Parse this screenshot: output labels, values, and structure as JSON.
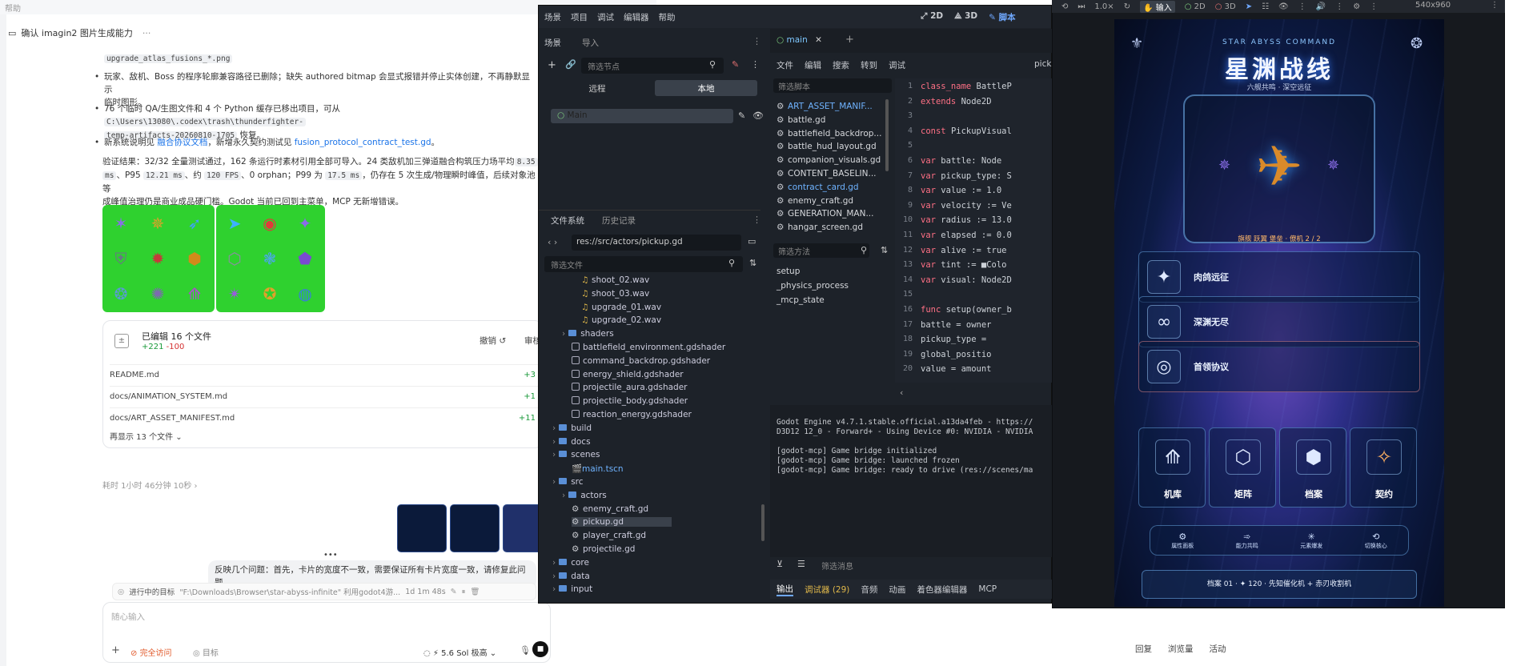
{
  "chat": {
    "top_strip": "帮助",
    "header_title": "确认 imagin2 图片生成能力",
    "header_more": "···",
    "frag_code": "upgrade_atlas_fusions_*.png",
    "bullet1_text": "玩家、敌机、Boss 的程序轮廓兼容路径已删除；缺失 authored bitmap 会显式报错并停止实体创建，不再静默显示",
    "bullet1_cont": "临时图形。",
    "bullet2_a": "76 个临时 QA/生图文件和 4 个 Python 缓存已移出项目，可从",
    "bullet2_code1": "C:\\Users\\13080\\.codex\\trash\\thunderfighter-",
    "bullet2_code2": "temp-artifacts-20260810-1705",
    "bullet2_b": "恢复。",
    "bullet3_a": "新系统说明见",
    "bullet3_link1": "融合协议文档",
    "bullet3_b": "，新增永久契约测试见",
    "bullet3_link2": "fusion_protocol_contract_test.gd",
    "bullet3_c": "。",
    "verify_1": "验证结果：32/32 全量测试通过，162 条运行时素材引用全部可导入。24 类敌机加三弹道融合构筑压力场平均",
    "verify_code1": "8.35",
    "verify_code2": "ms",
    "verify_2": "、P95",
    "verify_code3": "12.21 ms",
    "verify_3": "、约",
    "verify_code4": "120 FPS",
    "verify_4": "、0 orphan；P99 为",
    "verify_code5": "17.5 ms",
    "verify_5": "，仍存在 5 次生成/物理瞬时峰值，后续对象池等",
    "verify_6": "成峰值治理仍是商业成品硬门槛。Godot 当前已回到主菜单，MCP 无新增错误。",
    "edits_title": "已编辑 16 个文件",
    "edits_add": "+221",
    "edits_del": "-100",
    "undo_label": "撤销",
    "review_label": "审核",
    "files": [
      {
        "name": "README.md",
        "delta": "+3"
      },
      {
        "name": "docs/ANIMATION_SYSTEM.md",
        "delta": "+1"
      },
      {
        "name": "docs/ART_ASSET_MANIFEST.md",
        "delta": "+11"
      }
    ],
    "show_more": "再显示 13 个文件",
    "elapsed": "耗时 1小时 46分钟 10秒",
    "user_msg": "反映几个问题：首先，卡片的宽度不一致，需要保证所有卡片宽度一致，请修复此问",
    "user_msg2": "题，",
    "task_label": "进行中的目标",
    "task_path": "\"F:\\Downloads\\Browser\\star-abyss-infinite\" 利用godot4游...",
    "task_time": "1d 1m 48s",
    "input_placeholder": "随心输入",
    "access_label": "完全访问",
    "goal_label": "目标",
    "model_label": "5.6 Sol 极高",
    "footer_links": [
      "回复",
      "浏览量",
      "活动"
    ]
  },
  "godot": {
    "menu": [
      "场景",
      "项目",
      "调试",
      "编辑器",
      "帮助"
    ],
    "modes": [
      "2D",
      "3D",
      "脚本"
    ],
    "scene_tabs": [
      "场景",
      "导入"
    ],
    "filter_nodes": "筛选节点",
    "remote": "远程",
    "local": "本地",
    "root_node": "Main",
    "fs_tabs": [
      "文件系统",
      "历史记录"
    ],
    "fs_path": "res://src/actors/pickup.gd",
    "filter_files": "筛选文件",
    "fs_items": [
      {
        "label": "shoot_02.wav",
        "kind": "audio",
        "indent": 3
      },
      {
        "label": "shoot_03.wav",
        "kind": "audio",
        "indent": 3
      },
      {
        "label": "upgrade_01.wav",
        "kind": "audio",
        "indent": 3
      },
      {
        "label": "upgrade_02.wav",
        "kind": "audio",
        "indent": 3
      },
      {
        "label": "shaders",
        "kind": "folder",
        "indent": 1
      },
      {
        "label": "battlefield_environment.gdshader",
        "kind": "shader",
        "indent": 2
      },
      {
        "label": "command_backdrop.gdshader",
        "kind": "shader",
        "indent": 2
      },
      {
        "label": "energy_shield.gdshader",
        "kind": "shader",
        "indent": 2
      },
      {
        "label": "projectile_aura.gdshader",
        "kind": "shader",
        "indent": 2
      },
      {
        "label": "projectile_body.gdshader",
        "kind": "shader",
        "indent": 2
      },
      {
        "label": "reaction_energy.gdshader",
        "kind": "shader",
        "indent": 2
      },
      {
        "label": "build",
        "kind": "folder",
        "indent": 0
      },
      {
        "label": "docs",
        "kind": "folder",
        "indent": 0
      },
      {
        "label": "scenes",
        "kind": "folder",
        "indent": 0
      },
      {
        "label": "main.tscn",
        "kind": "scene",
        "indent": 2
      },
      {
        "label": "src",
        "kind": "folder",
        "indent": 0
      },
      {
        "label": "actors",
        "kind": "folder",
        "indent": 1
      },
      {
        "label": "enemy_craft.gd",
        "kind": "script",
        "indent": 2
      },
      {
        "label": "pickup.gd",
        "kind": "script",
        "indent": 2,
        "selected": true
      },
      {
        "label": "player_craft.gd",
        "kind": "script",
        "indent": 2
      },
      {
        "label": "projectile.gd",
        "kind": "script",
        "indent": 2
      },
      {
        "label": "core",
        "kind": "folder",
        "indent": 0
      },
      {
        "label": "data",
        "kind": "folder",
        "indent": 0
      },
      {
        "label": "input",
        "kind": "folder",
        "indent": 0
      }
    ],
    "editor_tab": "main",
    "script_menu": [
      "文件",
      "编辑",
      "搜索",
      "转到",
      "调试"
    ],
    "script_menu_right": "pick",
    "filter_scripts": "筛选脚本",
    "scripts": [
      "ART_ASSET_MANIF...",
      "battle.gd",
      "battlefield_backdrop...",
      "battle_hud_layout.gd",
      "companion_visuals.gd",
      "CONTENT_BASELIN...",
      "contract_card.gd",
      "enemy_craft.gd",
      "GENERATION_MAN...",
      "hangar_screen.gd"
    ],
    "filter_methods": "筛选方法",
    "methods": [
      "setup",
      "_physics_process",
      "_mcp_state"
    ],
    "code": [
      {
        "n": "1",
        "t": "class_name BattleP"
      },
      {
        "n": "2",
        "t": "extends Node2D"
      },
      {
        "n": "3",
        "t": ""
      },
      {
        "n": "4",
        "t": "const PickupVisual"
      },
      {
        "n": "5",
        "t": ""
      },
      {
        "n": "6",
        "t": "var battle: Node"
      },
      {
        "n": "7",
        "t": "var pickup_type: S"
      },
      {
        "n": "8",
        "t": "var value := 1.0"
      },
      {
        "n": "9",
        "t": "var velocity := Ve"
      },
      {
        "n": "10",
        "t": "var radius := 13.0"
      },
      {
        "n": "11",
        "t": "var elapsed := 0.0"
      },
      {
        "n": "12",
        "t": "var alive := true"
      },
      {
        "n": "13",
        "t": "var tint := ■Colo"
      },
      {
        "n": "14",
        "t": "var visual: Node2D"
      },
      {
        "n": "15",
        "t": ""
      },
      {
        "n": "16",
        "t": "func setup(owner_b"
      },
      {
        "n": "17",
        "t": "    battle = owner"
      },
      {
        "n": "18",
        "t": "    pickup_type = "
      },
      {
        "n": "19",
        "t": "    global_positio"
      },
      {
        "n": "20",
        "t": "    value = amount"
      }
    ],
    "console": [
      "Godot Engine v4.7.1.stable.official.a13da4feb - https://",
      "D3D12 12_0 - Forward+ - Using Device #0: NVIDIA - NVIDIA",
      "",
      "[godot-mcp] Game bridge initialized",
      "[godot-mcp] Game bridge: launched frozen",
      "[godot-mcp] Game bridge: ready to drive (res://scenes/ma"
    ],
    "filter_messages": "筛选消息",
    "bottom_tabs": [
      "输出",
      "调试器 (29)",
      "音频",
      "动画",
      "着色器编辑器",
      "MCP"
    ]
  },
  "game": {
    "toolbar_zoom": "1.0×",
    "toolbar_input": "输入",
    "toolbar_2d": "2D",
    "toolbar_3d": "3D",
    "resolution": "540x960",
    "eyebrow": "STAR ABYSS COMMAND",
    "title": "星渊战线",
    "subtitle": "六舰共鸣 · 深空远征",
    "ship_caption": "旗舰 跃翼 堡垒 · 僚机 2 / 2",
    "menu_items": [
      "肉鸽远征",
      "深渊无尽",
      "首领协议"
    ],
    "menu_icons": [
      "✦",
      "∞",
      "◎"
    ],
    "grid_items": [
      "机库",
      "矩阵",
      "档案",
      "契约"
    ],
    "grid_icons": [
      "⟰",
      "⬡",
      "⬢",
      "✧"
    ],
    "mini": [
      "属性面板",
      "能力共鸣",
      "元素爆发",
      "切换核心"
    ],
    "status": "档案 01 · ✦ 120 · 先知催化机 + 赤刃收割机"
  }
}
